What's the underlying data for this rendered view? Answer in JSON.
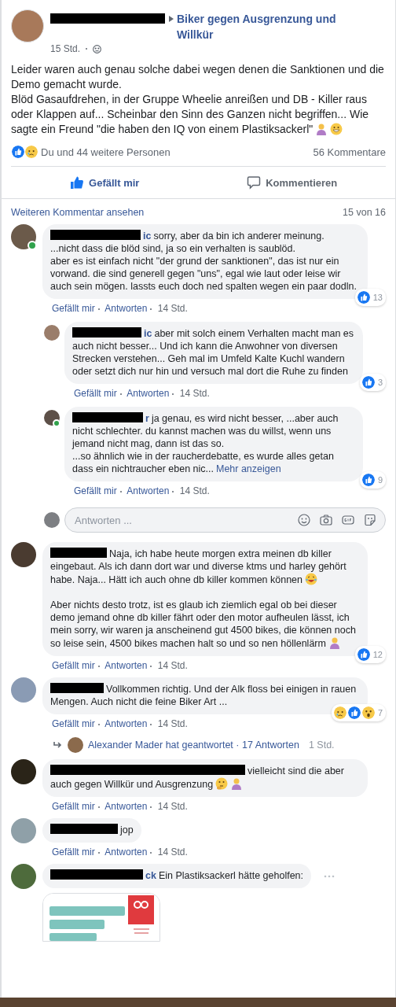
{
  "post": {
    "group": "Biker gegen Ausgrenzung und Willkür",
    "time": "15 Std.",
    "paragraphs": [
      {
        "text": "Leider waren auch genau solche dabei wegen denen die Sanktionen und die Demo gemacht wurde."
      },
      {
        "text": "Blöd Gasaufdrehen, in der Gruppe Wheelie anreißen und DB - Killer raus oder Klappen auf... Scheinbar den Sinn des Ganzen nicht begriffen... Wie sagte ein Freund \"die haben den IQ von einem Plastiksackerl\"",
        "emoji": [
          {
            "kind": "person"
          },
          {
            "kind": "grin"
          }
        ]
      }
    ],
    "reactions": [
      {
        "kind": "like"
      },
      {
        "kind": "sad"
      }
    ],
    "reaction_text": "Du und 44 weitere Personen",
    "comment_count": "56 Kommentare",
    "actions": [
      {
        "kind": "like",
        "label": "Gefällt mir",
        "selected": true
      },
      {
        "kind": "comment",
        "label": "Kommentieren",
        "selected": false
      }
    ]
  },
  "comments_header": {
    "more": "Weiteren Kommentar ansehen",
    "count": "15 von 16"
  },
  "comments": [
    {
      "online": true,
      "author": {
        "tail": "ic"
      },
      "paragraphs": [
        {
          "text": "sorry, aber da bin ich anderer meinung.\n...nicht dass die blöd sind, ja so ein verhalten is saublöd.\naber es ist einfach nicht \"der grund der sanktionen\", das ist nur ein vorwand. die sind generell gegen \"uns\", egal wie laut oder leise wir auch sein mögen. lassts euch doch ned spalten wegen ein paar dodln."
        }
      ],
      "reactions": [
        {
          "kind": "like"
        }
      ],
      "reaction_count": "13",
      "meta": {
        "like": "Gefällt mir",
        "reply": "Antworten",
        "time": "14 Std."
      },
      "replies": [
        {
          "author": {
            "tail": "ic"
          },
          "paragraphs": [
            {
              "text": "aber mit solch einem Verhalten macht man es auch nicht besser... Und ich kann die Anwohner von diversen Strecken verstehen... Geh mal im Umfeld Kalte Kuchl wandern oder setzt dich nur hin und versuch mal dort die Ruhe zu finden"
            }
          ],
          "reactions": [
            {
              "kind": "like"
            }
          ],
          "reaction_count": "3",
          "meta": {
            "like": "Gefällt mir",
            "reply": "Antworten",
            "time": "14 Std."
          }
        },
        {
          "online": true,
          "author": {
            "tail": "r"
          },
          "paragraphs": [
            {
              "text": "ja genau, es wird nicht besser, ...aber auch nicht schlechter. du kannst machen was du willst, wenn uns jemand nicht mag, dann ist das so.\n...so ähnlich wie in der raucherdebatte, es wurde alles getan dass ein nichtraucher eben nic..."
            }
          ],
          "more": "Mehr anzeigen",
          "reactions": [
            {
              "kind": "like"
            }
          ],
          "reaction_count": "9",
          "meta": {
            "like": "Gefällt mir",
            "reply": "Antworten",
            "time": "14 Std."
          }
        }
      ],
      "reply_box": {
        "placeholder": "Antworten ..."
      }
    },
    {
      "paragraphs": [
        {
          "text": "Naja, ich habe heute morgen extra meinen db killer eingebaut. Als ich dann dort war und diverse ktms und harley gehört habe. Naja... Hätt ich auch ohne db killer kommen können",
          "emoji": [
            {
              "kind": "laugh"
            }
          ]
        },
        {
          "text": "Aber nichts desto trotz, ist es glaub ich ziemlich egal ob bei dieser demo jemand ohne db killer fährt oder den motor aufheulen lässt, ich mein sorry, wir waren ja anscheinend gut 4500 bikes, die können noch so leise sein, 4500 bikes machen halt so und so nen höllenlärm",
          "emoji": [
            {
              "kind": "person"
            }
          ]
        }
      ],
      "reactions": [
        {
          "kind": "like"
        }
      ],
      "reaction_count": "12",
      "meta": {
        "like": "Gefällt mir",
        "reply": "Antworten",
        "time": "14 Std."
      }
    },
    {
      "paragraphs": [
        {
          "text": "Vollkommen richtig. Und der Alk floss bei einigen in rauen Mengen. Auch nicht die feine Biker Art ..."
        }
      ],
      "reactions": [
        {
          "kind": "sad"
        },
        {
          "kind": "like"
        },
        {
          "kind": "wow"
        }
      ],
      "reaction_count": "7",
      "meta": {
        "like": "Gefällt mir",
        "reply": "Antworten",
        "time": "14 Std."
      },
      "replies_summary": {
        "text": "Alexander Mader hat geantwortet · 17 Antworten",
        "time": "1 Std."
      }
    },
    {
      "paragraphs": [
        {
          "text": "vielleicht sind die aber auch gegen Willkür und Ausgrenzung",
          "emoji": [
            {
              "kind": "think"
            },
            {
              "kind": "person"
            }
          ]
        }
      ],
      "meta": {
        "like": "Gefällt mir",
        "reply": "Antworten",
        "time": "14 Std."
      }
    },
    {
      "paragraphs": [
        {
          "text": "jop"
        }
      ],
      "meta": {
        "like": "Gefällt mir",
        "reply": "Antworten",
        "time": "14 Std."
      }
    },
    {
      "author": {
        "tail": "ck"
      },
      "paragraphs": [
        {
          "text": "Ein Plastiksackerl hätte geholfen:"
        }
      ],
      "options": true,
      "attachment": {
        "kind": "picture"
      }
    }
  ]
}
